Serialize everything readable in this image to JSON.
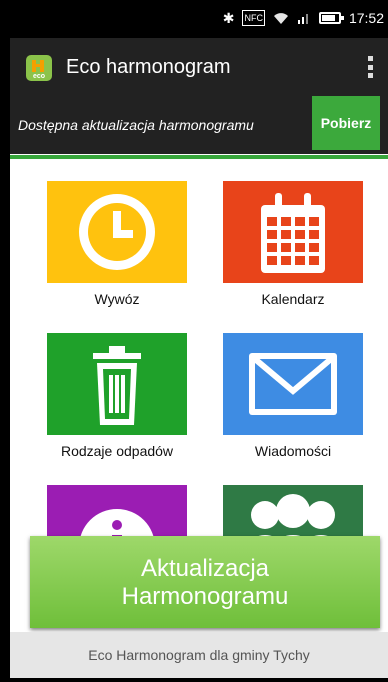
{
  "status_bar": {
    "time": "17:52",
    "icons": [
      "bluetooth-icon",
      "nfc-icon",
      "wifi-icon",
      "signal-icon",
      "battery-icon"
    ],
    "nfc_label": "NFC",
    "battery_level": 0.8
  },
  "app_bar": {
    "title": "Eco harmonogram",
    "logo_text": "eco"
  },
  "update_notice": {
    "text": "Dostępna aktualizacja harmonogramu",
    "button": "Pobierz"
  },
  "tiles": [
    {
      "label": "Wywóz",
      "icon": "clock-icon",
      "color": "#ffc20e"
    },
    {
      "label": "Kalendarz",
      "icon": "calendar-icon",
      "color": "#e8441a"
    },
    {
      "label": "Rodzaje odpadów",
      "icon": "trash-icon",
      "color": "#1fa12a"
    },
    {
      "label": "Wiadomości",
      "icon": "mail-icon",
      "color": "#3e8ce3"
    },
    {
      "label": "",
      "icon": "info-icon",
      "color": "#9b1db3"
    },
    {
      "label": "",
      "icon": "people-icon",
      "color": "#2f7a45"
    }
  ],
  "update_button": {
    "line1": "Aktualizacja",
    "line2": "Harmonogramu"
  },
  "footer": {
    "text": "Eco Harmonogram dla gminy Tychy"
  }
}
